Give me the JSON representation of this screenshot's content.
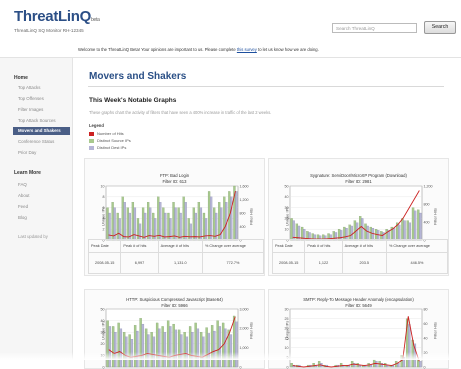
{
  "header": {
    "logo": "ThreatLinQ",
    "logo_suffix": "beta",
    "subtitle": "ThreatLinQ SQ Monitor RH-12345",
    "search_placeholder": "Search ThreatLinQ",
    "search_button": "Search"
  },
  "welcome": {
    "text_before": "Welcome to the ThreatLinQ Beta! Your opinions are important to us. Please complete",
    "link": "this survey",
    "text_after": "to let us know how we are doing."
  },
  "sidebar": {
    "home_head": "Home",
    "items": [
      {
        "label": "Top Attacks",
        "active": false
      },
      {
        "label": "Top Offenses",
        "active": false
      },
      {
        "label": "Filter Images",
        "active": false
      },
      {
        "label": "Top Attack Sources",
        "active": false
      },
      {
        "label": "Movers and Shakers",
        "active": true
      },
      {
        "label": "Conference Status",
        "active": false
      },
      {
        "label": "Prior Day",
        "active": false
      }
    ],
    "learn_head": "Learn More",
    "learn_items": [
      "FAQ",
      "About",
      "Feed",
      "Blog"
    ],
    "footer": "Last updated by"
  },
  "main": {
    "title": "Movers and Shakers",
    "section_title": "This Week's Notable Graphs",
    "section_desc": "These graphs chart the activity of filters that have seen a 400% increase in traffic of the last 2 weeks.",
    "legend_title": "Legend",
    "legend": [
      {
        "label": "Number of Hits",
        "color": "#cc2222"
      },
      {
        "label": "Distinct Source IPs",
        "color": "#a8c98e"
      },
      {
        "label": "Distinct Dest IPs",
        "color": "#b5b5d6"
      }
    ]
  },
  "cards": [
    {
      "title_line1": "FTP: Bad Login",
      "title_line2": "Filter ID: 613",
      "ylabel_left": "Unique IPs",
      "ylabel_right": "Filter Hits",
      "left_ticks": [
        "10",
        "8",
        "6",
        "4",
        "2",
        "0"
      ],
      "right_ticks": [
        "1,600",
        "1,200",
        "800",
        "400",
        "0"
      ],
      "table_headers": [
        "Peak Date",
        "Peak # of hits",
        "Average # of hits",
        "% Change over average"
      ],
      "table_row": [
        "2008-05-15",
        "6,997",
        "1,131.0",
        "772.7%"
      ]
    },
    {
      "title_line1": "Sygnature: ServiDoor/MicroXP Program (Download)",
      "title_line2": "Filter ID: 2981",
      "ylabel_left": "Unique IPs",
      "ylabel_right": "Filter Hits",
      "left_ticks": [
        "50",
        "40",
        "30",
        "20",
        "10",
        "0"
      ],
      "right_ticks": [
        "1,200",
        "800",
        "400",
        "0"
      ],
      "table_headers": [
        "Peak Date",
        "Peak # of hits",
        "Average # of hits",
        "% Change over average"
      ],
      "table_row": [
        "2008-05-15",
        "1,122",
        "203.5",
        "446.5%"
      ]
    },
    {
      "title_line1": "HTTP: Suspicious Compressed Javascript (Base64)",
      "title_line2": "Filter ID: 5966",
      "ylabel_left": "Unique IPs",
      "ylabel_right": "Filter Hits",
      "left_ticks": [
        "50",
        "40",
        "30",
        "20",
        "10",
        "0"
      ],
      "right_ticks": [
        "3,000",
        "2,000",
        "1,000",
        "0"
      ]
    },
    {
      "title_line1": "SMTP: Reply-To Message Header Anomaly (encapsulation)",
      "title_line2": "Filter ID: 5649",
      "ylabel_left": "Unique IPs",
      "ylabel_right": "Filter Hits",
      "left_ticks": [
        "30",
        "25",
        "20",
        "15",
        "10",
        "5",
        "0"
      ],
      "right_ticks": [
        "80",
        "60",
        "40",
        "20",
        "0"
      ]
    }
  ],
  "chart_data": [
    {
      "type": "bar",
      "title": "FTP: Bad Login",
      "ylabel": "Unique IPs",
      "y2label": "Filter Hits",
      "ylim": [
        0,
        10
      ],
      "y2lim": [
        0,
        1600
      ],
      "series": [
        {
          "name": "Distinct Source IPs",
          "values": [
            6,
            7,
            5,
            8,
            6,
            7,
            4,
            6,
            7,
            5,
            8,
            6,
            5,
            7,
            6,
            8,
            4,
            6,
            7,
            5,
            9,
            6,
            7,
            8,
            9,
            10
          ]
        },
        {
          "name": "Distinct Dest IPs",
          "values": [
            5,
            6,
            4,
            7,
            5,
            6,
            3,
            5,
            6,
            4,
            7,
            5,
            4,
            6,
            5,
            7,
            3,
            5,
            6,
            4,
            8,
            5,
            6,
            7,
            8,
            9
          ]
        },
        {
          "name": "Number of Hits",
          "values": [
            150,
            120,
            200,
            100,
            90,
            160,
            120,
            80,
            130,
            110,
            140,
            90,
            100,
            120,
            80,
            110,
            95,
            100,
            90,
            120,
            130,
            110,
            160,
            400,
            800,
            1450
          ]
        }
      ]
    },
    {
      "type": "bar",
      "title": "Sygnature: ServiDoor/MicroXP Program (Download)",
      "ylabel": "Unique IPs",
      "y2label": "Filter Hits",
      "ylim": [
        0,
        50
      ],
      "y2lim": [
        0,
        1200
      ],
      "series": [
        {
          "name": "Distinct Source IPs",
          "values": [
            20,
            15,
            12,
            8,
            6,
            5,
            5,
            6,
            8,
            10,
            12,
            14,
            18,
            22,
            15,
            12,
            10,
            8,
            10,
            12,
            16,
            20,
            18,
            30,
            28
          ]
        },
        {
          "name": "Distinct Dest IPs",
          "values": [
            18,
            13,
            10,
            7,
            5,
            4,
            4,
            5,
            7,
            9,
            11,
            13,
            16,
            20,
            13,
            11,
            9,
            7,
            9,
            11,
            14,
            18,
            16,
            27,
            25
          ]
        },
        {
          "name": "Number of Hits",
          "values": [
            60,
            50,
            40,
            30,
            20,
            20,
            20,
            30,
            40,
            50,
            70,
            100,
            200,
            300,
            200,
            150,
            120,
            100,
            180,
            250,
            350,
            500,
            700,
            900,
            1100
          ]
        }
      ]
    },
    {
      "type": "bar",
      "title": "HTTP: Suspicious Compressed Javascript (Base64)",
      "ylabel": "Unique IPs",
      "y2label": "Filter Hits",
      "ylim": [
        0,
        50
      ],
      "y2lim": [
        0,
        3000
      ],
      "series": [
        {
          "name": "Distinct Source IPs",
          "values": [
            40,
            35,
            38,
            30,
            28,
            36,
            42,
            33,
            30,
            38,
            35,
            40,
            37,
            32,
            30,
            35,
            38,
            30,
            34,
            36,
            40,
            38,
            32,
            44
          ]
        },
        {
          "name": "Distinct Dest IPs",
          "values": [
            35,
            30,
            33,
            26,
            24,
            31,
            37,
            28,
            26,
            33,
            30,
            35,
            32,
            28,
            26,
            30,
            33,
            26,
            29,
            31,
            35,
            33,
            28,
            39
          ]
        },
        {
          "name": "Number of Hits",
          "values": [
            900,
            700,
            800,
            600,
            500,
            550,
            600,
            700,
            650,
            600,
            550,
            500,
            600,
            650,
            700,
            600,
            550,
            500,
            650,
            800,
            900,
            1200,
            1800,
            2600
          ]
        }
      ]
    },
    {
      "type": "bar",
      "title": "SMTP: Reply-To Message Header Anomaly (encapsulation)",
      "ylabel": "Unique IPs",
      "y2label": "Filter Hits",
      "ylim": [
        0,
        30
      ],
      "y2lim": [
        0,
        80
      ],
      "series": [
        {
          "name": "Distinct Source IPs",
          "values": [
            2,
            1,
            0,
            1,
            2,
            3,
            1,
            0,
            1,
            2,
            1,
            3,
            2,
            1,
            2,
            4,
            3,
            2,
            1,
            3,
            6,
            25,
            14,
            4
          ]
        },
        {
          "name": "Distinct Dest IPs",
          "values": [
            1,
            1,
            0,
            1,
            1,
            2,
            1,
            0,
            1,
            1,
            1,
            2,
            1,
            1,
            1,
            3,
            2,
            1,
            1,
            2,
            5,
            22,
            12,
            3
          ]
        },
        {
          "name": "Number of Hits",
          "values": [
            2,
            1,
            0,
            1,
            2,
            3,
            1,
            0,
            1,
            2,
            2,
            4,
            3,
            2,
            3,
            5,
            4,
            3,
            2,
            5,
            10,
            70,
            30,
            8
          ]
        }
      ]
    }
  ]
}
